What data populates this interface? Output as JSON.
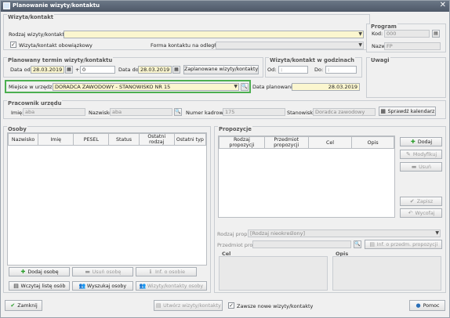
{
  "window": {
    "title": "Planowanie wizyty/kontaktu",
    "close": "✕"
  },
  "wizyta": {
    "title": "Wizyta/kontakt",
    "rodzaj_label": "Rodzaj wizyty/kontaktu:",
    "rodzaj_value": "",
    "obowiazkowy_label": "Wizyta/kontakt obowiązkowy",
    "obowiazkowy_checked": "✓",
    "forma_label": "Forma kontaktu na odległość:",
    "forma_value": ""
  },
  "program": {
    "title": "Program",
    "kod_label": "Kod:",
    "kod_value": "000",
    "nazwa_label": "Nazwa:",
    "nazwa_value": "FP"
  },
  "termin": {
    "title": "Planowany termin wizyty/kontaktu",
    "data_od_label": "Data od:",
    "data_od_value": "28.03.2019",
    "plus_label": "+",
    "plus_value": "0",
    "data_do_label": "Data do:",
    "data_do_value": "28.03.2019",
    "zaplanowane_button": "Zaplanowane wizyty/kontakty"
  },
  "godziny": {
    "title": "Wizyta/kontakt w godzinach",
    "od_label": "Od:",
    "od_value": ":",
    "do_label": "Do:",
    "do_value": ":"
  },
  "uwagi": {
    "title": "Uwagi"
  },
  "miejsce": {
    "label": "Miejsce w urzędzie:",
    "value": "DORADCA ZAWODOWY - STANOWISKO NR 15",
    "data_plan_label": "Data planowania:",
    "data_plan_value": "28.03.2019"
  },
  "pracownik": {
    "title": "Pracownik urzędu",
    "imie_label": "Imię:",
    "imie_value": "aba",
    "nazwisko_label": "Nazwisko:",
    "nazwisko_value": "aba",
    "numer_label": "Numer kadrowy:",
    "numer_value": "175",
    "stanowisko_label": "Stanowisko:",
    "stanowisko_value": "Doradca zawodowy",
    "kalendarz_button": "Sprawdź kalendarz"
  },
  "osoby": {
    "title": "Osoby",
    "columns": [
      "Nazwisko",
      "Imię",
      "PESEL",
      "Status",
      "Ostatni rodzaj",
      "Ostatni typ"
    ],
    "buttons": {
      "dodaj": "Dodaj osobę",
      "usun": "Usuń osobę",
      "inf": "Inf. o osobie",
      "wczytaj": "Wczytaj listę osób",
      "wyszukaj": "Wyszukaj osoby",
      "wizyty": "Wizyty/kontakty osoby"
    }
  },
  "propozycje": {
    "title": "Propozycje",
    "columns": [
      "Rodzaj propozycji",
      "Przedmiot propozycji",
      "Cel",
      "Opis"
    ],
    "buttons": {
      "dodaj": "Dodaj",
      "modyfikuj": "Modyfikuj",
      "usun": "Usuń",
      "zapisz": "Zapisz",
      "wycofaj": "Wycofaj"
    },
    "rodzaj_label": "Rodzaj prop.",
    "rodzaj_value": "[Rodzaj nieokreślony]",
    "przedmiot_label": "Przedmiot prop.",
    "inf_button": "Inf. o przedm. propozycji",
    "cel_label": "Cel",
    "opis_label": "Opis"
  },
  "footer": {
    "zamknij": "Zamknij",
    "utworz": "Utwórz wizyty/kontakty",
    "zawsze_label": "Zawsze nowe wizyty/kontakty",
    "zawsze_checked": "✓",
    "pomoc": "Pomoc"
  },
  "colors": {
    "highlight": "#4caf50",
    "required": "#fbf6cf",
    "titlebar": "#5a6676"
  },
  "icons": [
    "window-icon",
    "close-icon",
    "dropdown-arrow-icon",
    "calendar-icon",
    "search-icon",
    "plus-icon",
    "minus-icon",
    "info-icon",
    "check-icon",
    "undo-icon",
    "help-icon",
    "document-icon",
    "list-icon",
    "people-icon"
  ]
}
